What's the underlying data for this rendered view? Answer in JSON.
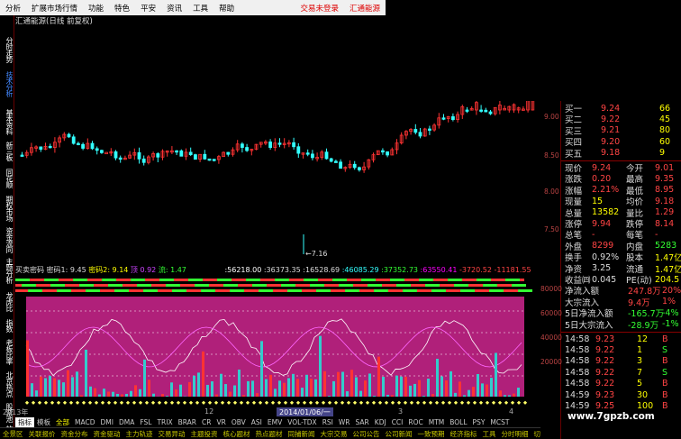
{
  "menu": {
    "items": [
      "分析",
      "扩展市场行情",
      "资讯",
      "工具",
      "帮助"
    ],
    "left_items": [
      "扩展市场行情",
      "功能",
      "报价",
      "分析",
      "行情"
    ],
    "right_items": [
      "交易未登录",
      "汇通能源"
    ],
    "labels": [
      "分析",
      "扩展市场行情",
      "功能",
      "特色",
      "平安",
      "资讯",
      "工具",
      "帮助"
    ]
  },
  "left_tabs": [
    "分时走势",
    "技术分析",
    "基本资料",
    "新三板",
    "同花顺",
    "期权市场",
    "资金流向",
    "主题分析",
    "龙虎比",
    "指数",
    "老板比率",
    "北京热点",
    "股票池",
    "放量",
    "选择"
  ],
  "chart_title": "汇通能源(日线 前复权)",
  "price_marks": {
    "low": "←7.16",
    "axis": [
      "9.00",
      "8.50",
      "8.00",
      "7.50"
    ]
  },
  "indicator_bar": {
    "name": "买卖密码",
    "pw1": "密码1: 9.45",
    "pw2": "密码2: 9.14",
    "peak": "顶 0.92",
    "flow": "流: 1.47",
    "v1": ":56218.00",
    "v2": ":36373.35",
    "v3": ":16528.69",
    "v4": ":46085.29",
    "v5": ":37352.73",
    "v6": ":63550.41",
    "v7": "-3720.52",
    "v8": "-11181.55"
  },
  "ind_axis": [
    "80000",
    "60000",
    "40000",
    "20000"
  ],
  "date_bar": {
    "left": "2013年",
    "mid1": "12",
    "cur": "2014/01/06/一",
    "mid2": "3",
    "mid3": "4"
  },
  "tabs": [
    "指标",
    "模板",
    "全部",
    "MACD",
    "DMI",
    "DMA",
    "FSL",
    "TRIX",
    "BRAR",
    "CR",
    "VR",
    "OBV",
    "ASI",
    "EMV",
    "VOL-TDX",
    "RSI",
    "WR",
    "SAR",
    "KDJ",
    "CCI",
    "ROC",
    "MTM",
    "BOLL",
    "PSY",
    "MCST"
  ],
  "bottom": [
    "全景区",
    "关联报价",
    "资金分布",
    "资金驱动",
    "主力轨迹",
    "交易异动",
    "主题投资",
    "核心题材",
    "热点题材",
    "同捕新闻",
    "大宗交易",
    "公司公告",
    "公司新闻",
    "一致预期",
    "经济指标",
    "工具",
    "分时明细",
    "切"
  ],
  "quote": {
    "asks": [
      [
        "买一",
        "9.24",
        "66"
      ],
      [
        "买二",
        "9.22",
        "45"
      ],
      [
        "买三",
        "9.21",
        "80"
      ],
      [
        "买四",
        "9.20",
        "60"
      ],
      [
        "买五",
        "9.18",
        "9"
      ]
    ],
    "stats": [
      [
        "现价",
        "9.24",
        "今开",
        "9.01"
      ],
      [
        "涨跌",
        "0.20",
        "最高",
        "9.35"
      ],
      [
        "涨幅",
        "2.21%",
        "最低",
        "8.95"
      ],
      [
        "现量",
        "15",
        "均价",
        "9.18"
      ],
      [
        "总量",
        "13582",
        "量比",
        "1.29"
      ],
      [
        "涨停",
        "9.94",
        "跌停",
        "8.14"
      ],
      [
        "总笔",
        "-",
        "每笔",
        "-"
      ],
      [
        "外盘",
        "8299",
        "内盘",
        "5283"
      ]
    ],
    "extra": [
      [
        "换手",
        "0.92%",
        "股本",
        "1.47亿"
      ],
      [
        "净资",
        "3.25",
        "流通",
        "1.47亿"
      ],
      [
        "收益㈣",
        "0.045",
        "PE(动)",
        "204.5"
      ]
    ],
    "flow": [
      [
        "净流入额",
        "247.8万",
        "20%"
      ],
      [
        "大宗流入",
        "9.4万",
        "1%"
      ],
      [
        "5日净流入额",
        "-165.7万",
        "-4%"
      ],
      [
        "5日大宗流入",
        "-28.9万",
        "-1%"
      ]
    ],
    "ticks": [
      [
        "14:58",
        "9.23",
        "12",
        "B"
      ],
      [
        "14:58",
        "9.22",
        "1",
        "S"
      ],
      [
        "14:58",
        "9.22",
        "3",
        "B"
      ],
      [
        "14:58",
        "9.22",
        "7",
        "S"
      ],
      [
        "14:58",
        "9.22",
        "5",
        "B"
      ],
      [
        "14:59",
        "9.23",
        "30",
        "B"
      ],
      [
        "14:59",
        "9.25",
        "100",
        "B"
      ]
    ]
  },
  "watermark": "www.7gpzb.com",
  "colors": {
    "up": "#ff3333",
    "down": "#33ffff",
    "magenta": "#b0207a",
    "green": "#33ff33",
    "yellow": "#ffff00"
  }
}
